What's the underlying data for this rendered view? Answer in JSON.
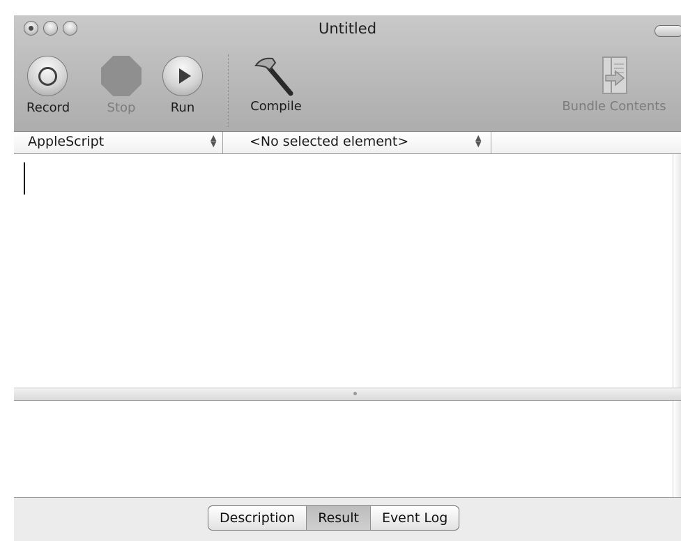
{
  "window": {
    "title": "Untitled"
  },
  "toolbar": {
    "record_label": "Record",
    "stop_label": "Stop",
    "run_label": "Run",
    "compile_label": "Compile",
    "bundle_label": "Bundle Contents"
  },
  "navbar": {
    "language": "AppleScript",
    "element": "<No selected element>"
  },
  "editor": {
    "text": ""
  },
  "bottom_tabs": {
    "description": "Description",
    "result": "Result",
    "event_log": "Event Log",
    "selected": "Result"
  },
  "icons": [
    "record-icon",
    "stop-icon",
    "run-icon",
    "hammer-icon",
    "bundle-contents-icon"
  ],
  "colors": {
    "toolbar_gray": "#bdbdbd",
    "disabled_text": "#7c7c7c"
  }
}
